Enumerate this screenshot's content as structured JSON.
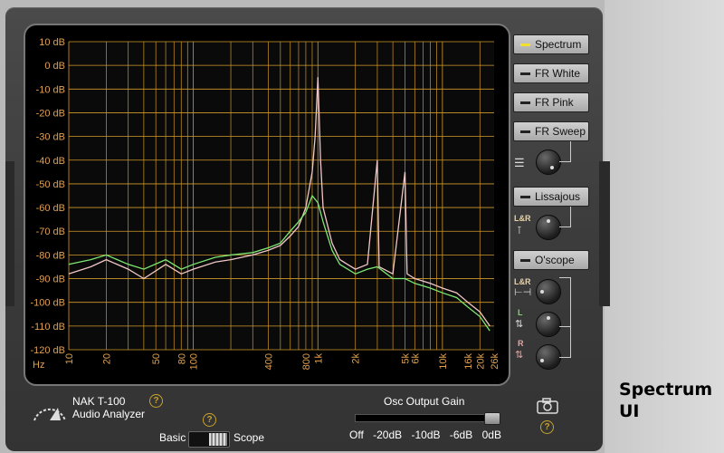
{
  "caption": {
    "line1": "Spectrum",
    "line2": "UI"
  },
  "app": {
    "name": "NAK T-100",
    "subtitle": "Audio Analyzer"
  },
  "mode_switch": {
    "left_label": "Basic",
    "right_label": "Scope"
  },
  "osc": {
    "title": "Osc Output Gain",
    "ticks": [
      "Off",
      "-20dB",
      "-10dB",
      "-6dB",
      "0dB"
    ],
    "level": 1.0
  },
  "buttons": {
    "spectrum": "Spectrum",
    "fr_white": "FR White",
    "fr_pink": "FR Pink",
    "fr_sweep": "FR Sweep",
    "lissajous": "Lissajous",
    "oscope": "O'scope"
  },
  "knob_labels": {
    "lissajous_lr": "L&R",
    "oscope_lr": "L&R",
    "oscope_l": "L",
    "oscope_r": "R"
  },
  "icons": [
    "ruler-icon",
    "vertical-scale-icon",
    "horizontal-scale-icon",
    "up-down-arrows-icon",
    "camera-icon",
    "help-icon"
  ],
  "colors": {
    "accent": "#f2e12a",
    "grid": "#d29a2a",
    "axis_label": "#e0a050",
    "series_1": "#7de872",
    "series_2": "#f0c6c6"
  },
  "chart_data": {
    "type": "line",
    "x_scale": "log",
    "xlim": [
      10,
      26000
    ],
    "ylim": [
      -120,
      10
    ],
    "x_unit": "Hz",
    "y_ticks": [
      "10 dB",
      "0 dB",
      "-10 dB",
      "-20 dB",
      "-30 dB",
      "-40 dB",
      "-50 dB",
      "-60 dB",
      "-70 dB",
      "-80 dB",
      "-90 dB",
      "-100 dB",
      "-110 dB",
      "-120 dB"
    ],
    "x_ticks": [
      "10",
      "20",
      "50",
      "80",
      "100",
      "400",
      "800",
      "1k",
      "2k",
      "5k",
      "6k",
      "10k",
      "16k",
      "20k",
      "26k"
    ],
    "x_tick_values": [
      10,
      20,
      50,
      80,
      100,
      400,
      800,
      1000,
      2000,
      5000,
      6000,
      10000,
      16000,
      20000,
      26000
    ],
    "grid": true,
    "series": [
      {
        "color": "#f0c6c6",
        "points": [
          [
            10,
            -88
          ],
          [
            15,
            -85
          ],
          [
            20,
            -82
          ],
          [
            30,
            -86
          ],
          [
            40,
            -90
          ],
          [
            60,
            -84
          ],
          [
            80,
            -88
          ],
          [
            100,
            -86
          ],
          [
            150,
            -83
          ],
          [
            200,
            -82
          ],
          [
            300,
            -80
          ],
          [
            400,
            -78
          ],
          [
            500,
            -76
          ],
          [
            600,
            -72
          ],
          [
            700,
            -68
          ],
          [
            800,
            -60
          ],
          [
            900,
            -45
          ],
          [
            950,
            -30
          ],
          [
            1000,
            -5
          ],
          [
            1050,
            -40
          ],
          [
            1100,
            -60
          ],
          [
            1300,
            -75
          ],
          [
            1500,
            -82
          ],
          [
            2000,
            -86
          ],
          [
            2500,
            -84
          ],
          [
            3000,
            -40
          ],
          [
            3100,
            -85
          ],
          [
            4000,
            -88
          ],
          [
            5000,
            -45
          ],
          [
            5200,
            -88
          ],
          [
            6000,
            -90
          ],
          [
            8000,
            -92
          ],
          [
            10000,
            -94
          ],
          [
            13000,
            -96
          ],
          [
            16000,
            -100
          ],
          [
            20000,
            -104
          ],
          [
            24000,
            -110
          ]
        ]
      },
      {
        "color": "#7de872",
        "points": [
          [
            10,
            -84
          ],
          [
            15,
            -82
          ],
          [
            20,
            -80
          ],
          [
            30,
            -84
          ],
          [
            40,
            -86
          ],
          [
            60,
            -82
          ],
          [
            80,
            -86
          ],
          [
            100,
            -84
          ],
          [
            150,
            -81
          ],
          [
            200,
            -80
          ],
          [
            300,
            -79
          ],
          [
            400,
            -77
          ],
          [
            500,
            -75
          ],
          [
            600,
            -70
          ],
          [
            700,
            -66
          ],
          [
            800,
            -62
          ],
          [
            900,
            -55
          ],
          [
            1000,
            -58
          ],
          [
            1100,
            -66
          ],
          [
            1300,
            -78
          ],
          [
            1500,
            -84
          ],
          [
            2000,
            -88
          ],
          [
            2500,
            -86
          ],
          [
            3000,
            -85
          ],
          [
            4000,
            -90
          ],
          [
            5000,
            -90
          ],
          [
            6000,
            -92
          ],
          [
            8000,
            -94
          ],
          [
            10000,
            -96
          ],
          [
            13000,
            -98
          ],
          [
            16000,
            -102
          ],
          [
            20000,
            -106
          ],
          [
            24000,
            -112
          ]
        ]
      }
    ]
  }
}
